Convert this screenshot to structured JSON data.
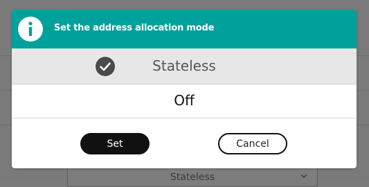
{
  "background": {
    "select_value": "Stateless"
  },
  "dialog": {
    "title": "Set the address allocation mode",
    "header_color": "#00a19b",
    "options": [
      {
        "label": "Stateless",
        "selected": true
      },
      {
        "label": "Off",
        "selected": false
      }
    ],
    "buttons": {
      "set": "Set",
      "cancel": "Cancel"
    }
  },
  "icons": {
    "header": "info-icon",
    "selected_option": "check-icon",
    "background_select": "chevron-down-icon"
  }
}
